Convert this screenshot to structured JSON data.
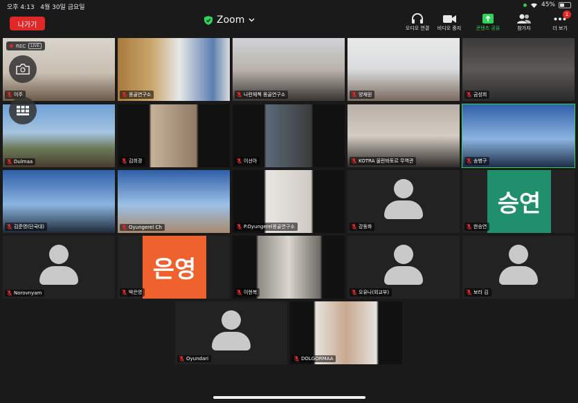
{
  "status": {
    "time": "오후 4:13",
    "date": "4월 30일 금요일",
    "battery": "45%",
    "battery_level": 0.45
  },
  "header": {
    "leave_label": "나가기",
    "app_title": "Zoom"
  },
  "toolbar": [
    {
      "label": "오디오 연결",
      "icon": "headphones-icon"
    },
    {
      "label": "비디오 중지",
      "icon": "video-camera-icon"
    },
    {
      "label": "콘텐츠 공유",
      "icon": "share-content-icon"
    },
    {
      "label": "참가자",
      "icon": "participants-icon"
    },
    {
      "label": "더 보기",
      "icon": "more-icon",
      "badge": "1"
    }
  ],
  "recording": {
    "rec_label": "REC",
    "live_label": "LIVE"
  },
  "participants": [
    {
      "name": "이주",
      "type": "video"
    },
    {
      "name": "몽골연구소",
      "type": "video"
    },
    {
      "name": "나란체첵 몽골연구소",
      "type": "video"
    },
    {
      "name": "양재원",
      "type": "video"
    },
    {
      "name": "금성희",
      "type": "video"
    },
    {
      "name": "Dulmaa",
      "type": "video"
    },
    {
      "name": "김희경",
      "type": "video"
    },
    {
      "name": "이선아",
      "type": "video"
    },
    {
      "name": "KOTRA 울란바토르 무역관",
      "type": "video"
    },
    {
      "name": "송병구",
      "type": "video",
      "active": true
    },
    {
      "name": "김준영(단국대)",
      "type": "video"
    },
    {
      "name": "Oyungerel Ch",
      "type": "video"
    },
    {
      "name": "P.Oyungerel몽골연구소",
      "type": "video"
    },
    {
      "name": "강동화",
      "type": "avatar"
    },
    {
      "name": "한승연",
      "type": "namecard",
      "card_text": "승연",
      "card_color": "#1f8f6c"
    },
    {
      "name": "Norovnyam",
      "type": "avatar"
    },
    {
      "name": "박은영",
      "type": "namecard",
      "card_text": "은영",
      "card_color": "#f0622d"
    },
    {
      "name": "이현복",
      "type": "video"
    },
    {
      "name": "오유나(외교부)",
      "type": "avatar"
    },
    {
      "name": "보라 김",
      "type": "avatar"
    },
    {
      "name": "Oyundari",
      "type": "avatar"
    },
    {
      "name": "DOLGORMAA",
      "type": "video"
    }
  ],
  "colors": {
    "leave": "#e02828",
    "active_speaker": "#2fd35a",
    "share_green": "#2fd35a"
  }
}
